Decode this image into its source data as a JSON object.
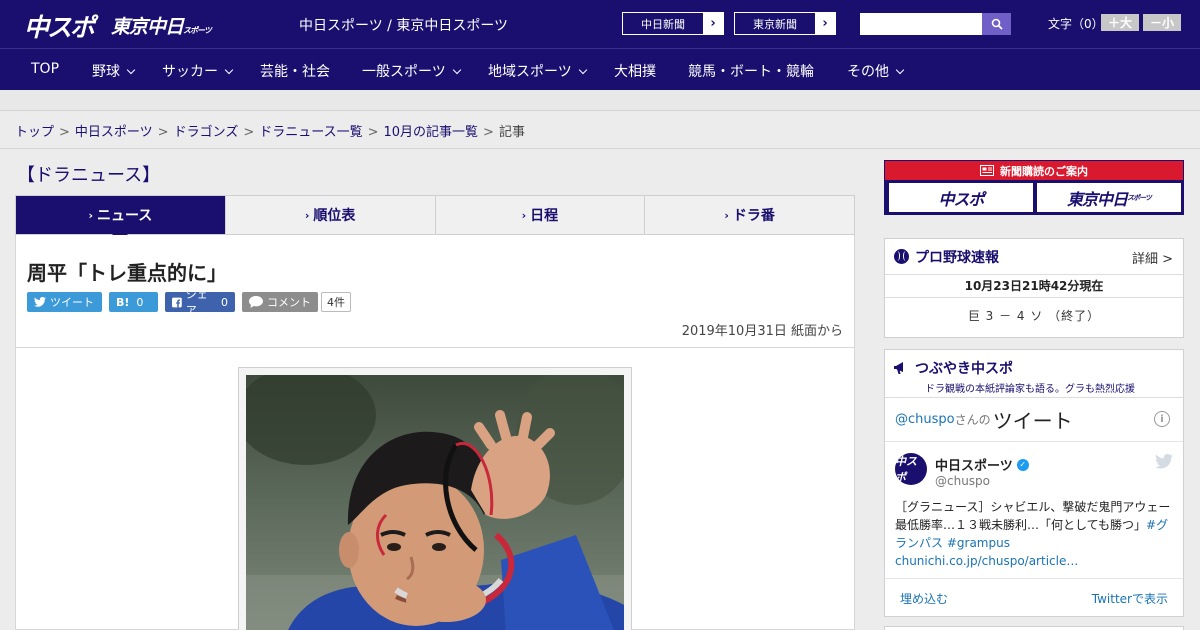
{
  "header": {
    "logo_chuspo": "中スポ",
    "logo_tokyo": "東京中日",
    "logo_tokyo_small": "スポーツ",
    "site_name": "中日スポーツ / 東京中日スポーツ",
    "ext_chunichi": "中日新聞",
    "ext_tokyo": "東京新聞",
    "search": {
      "value": "",
      "placeholder": ""
    },
    "font_size_label": "文字（0）",
    "font_large": "＋大",
    "font_small": "－小"
  },
  "nav": [
    {
      "label": "TOP",
      "has_menu": false
    },
    {
      "label": "野球",
      "has_menu": true
    },
    {
      "label": "サッカー",
      "has_menu": true
    },
    {
      "label": "芸能・社会",
      "has_menu": false
    },
    {
      "label": "一般スポーツ",
      "has_menu": true
    },
    {
      "label": "地域スポーツ",
      "has_menu": true
    },
    {
      "label": "大相撲",
      "has_menu": false
    },
    {
      "label": "競馬・ボート・競輪",
      "has_menu": false
    },
    {
      "label": "その他",
      "has_menu": true
    }
  ],
  "breadcrumb": [
    {
      "label": "トップ",
      "link": true
    },
    {
      "label": "中日スポーツ",
      "link": true
    },
    {
      "label": "ドラゴンズ",
      "link": true
    },
    {
      "label": "ドラニュース一覧",
      "link": true
    },
    {
      "label": "10月の記事一覧",
      "link": true
    },
    {
      "label": "記事",
      "link": false
    }
  ],
  "section_title": "【ドラニュース】",
  "tabs": [
    {
      "label": "ニュース",
      "active": true
    },
    {
      "label": "順位表",
      "active": false
    },
    {
      "label": "日程",
      "active": false
    },
    {
      "label": "ドラ番",
      "active": false
    }
  ],
  "article": {
    "headline": "周平「トレ重点的に」",
    "share": {
      "tweet": "ツイート",
      "hatena": "B!",
      "hatena_count": "0",
      "facebook": "シェア",
      "facebook_count": "0",
      "comment": "コメント",
      "comment_count": "4件"
    },
    "date": "2019年10月31日 紙面から"
  },
  "sidebar": {
    "ad": {
      "header": "新聞購読のご案内",
      "logo1": "中スポ",
      "logo2": "東京中日",
      "logo2_small": "スポーツ"
    },
    "score": {
      "title": "プロ野球速報",
      "more": "詳細 >",
      "time": "10月23日21時42分現在",
      "result": "巨 3 － 4 ソ （終了）"
    },
    "twitter": {
      "title": "つぶやき中スポ",
      "subtitle": "ドラ観戦の本紙評論家も語る。グラも熱烈応援",
      "handle": "@chuspo",
      "sanno": "さんの",
      "tweet_word": "ツイート",
      "user_name": "中日スポーツ",
      "screen_name": "@chuspo",
      "avatar_text": "中スポ",
      "tweet_text_1": "［グラニュース］シャビエル、撃破だ鬼門アウェー　最低勝率…１３戦未勝利…「何としても勝つ」",
      "tweet_tag_1": "#グランパス",
      "tweet_tag_2": "#grampus",
      "tweet_link": "chunichi.co.jp/chuspo/article…",
      "embed": "埋め込む",
      "view_on": "Twitterで表示"
    }
  },
  "colors": {
    "brand": "#1a0f6e",
    "accent_red": "#d8192e",
    "link": "#1a73b5"
  }
}
